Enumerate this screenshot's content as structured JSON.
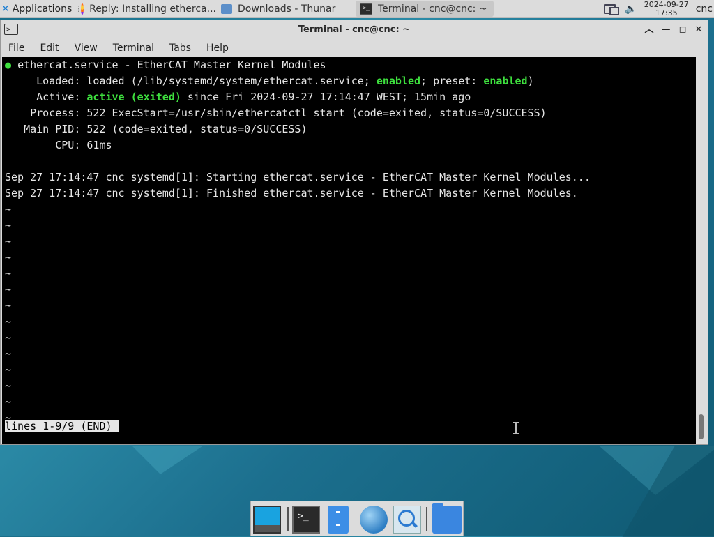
{
  "top_panel": {
    "applications_label": "Applications",
    "tasks": [
      {
        "label": "Reply: Installing etherca..."
      },
      {
        "label": "Downloads - Thunar"
      },
      {
        "label": "Terminal - cnc@cnc: ~"
      }
    ],
    "clock": {
      "date": "2024-09-27",
      "time": "17:35"
    },
    "user": "cnc"
  },
  "window": {
    "title": "Terminal - cnc@cnc: ~",
    "menu": [
      "File",
      "Edit",
      "View",
      "Terminal",
      "Tabs",
      "Help"
    ]
  },
  "terminal": {
    "bullet": "●",
    "service_line": "ethercat.service - EtherCAT Master Kernel Modules",
    "loaded": {
      "label": "Loaded:",
      "pre": "loaded (/lib/systemd/system/ethercat.service; ",
      "state": "enabled",
      "mid": "; preset: ",
      "preset": "enabled",
      "post": ")"
    },
    "active": {
      "label": "Active:",
      "state": "active (exited)",
      "rest": " since Fri 2024-09-27 17:14:47 WEST; 15min ago"
    },
    "process": {
      "label": "Process:",
      "value": "522 ExecStart=/usr/sbin/ethercatctl start (code=exited, status=0/SUCCESS)"
    },
    "main_pid": {
      "label": "Main PID:",
      "value": "522 (code=exited, status=0/SUCCESS)"
    },
    "cpu": {
      "label": "CPU:",
      "value": "61ms"
    },
    "log": [
      "Sep 27 17:14:47 cnc systemd[1]: Starting ethercat.service - EtherCAT Master Kernel Modules...",
      "Sep 27 17:14:47 cnc systemd[1]: Finished ethercat.service - EtherCAT Master Kernel Modules."
    ],
    "tilde": "~",
    "tilde_count": 14,
    "status": "lines 1-9/9 (END)"
  }
}
